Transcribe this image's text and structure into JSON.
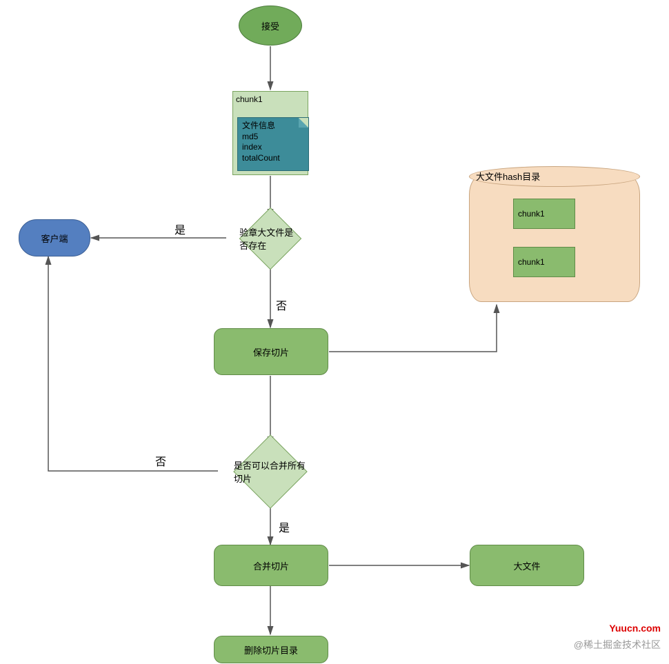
{
  "nodes": {
    "start": "接受",
    "chunk_box_title": "chunk1",
    "chunk_note_lines": {
      "l1": "文件信息",
      "l2": "md5",
      "l3": "index",
      "l4": "totalCount"
    },
    "decision1": "验章大文件是否存在",
    "client": "客户端",
    "save_chunk": "保存切片",
    "decision2": "是否可以合并所有切片",
    "merge_chunk": "合并切片",
    "big_file": "大文件",
    "delete_dir": "删除切片目录",
    "cylinder_label": "大文件hash目录",
    "cylinder_item1": "chunk1",
    "cylinder_item2": "chunk1"
  },
  "labels": {
    "yes1": "是",
    "no1": "否",
    "no2": "否",
    "yes2": "是"
  },
  "watermarks": {
    "site": "Yuucn.com",
    "community": "@稀土掘金技术社区"
  }
}
